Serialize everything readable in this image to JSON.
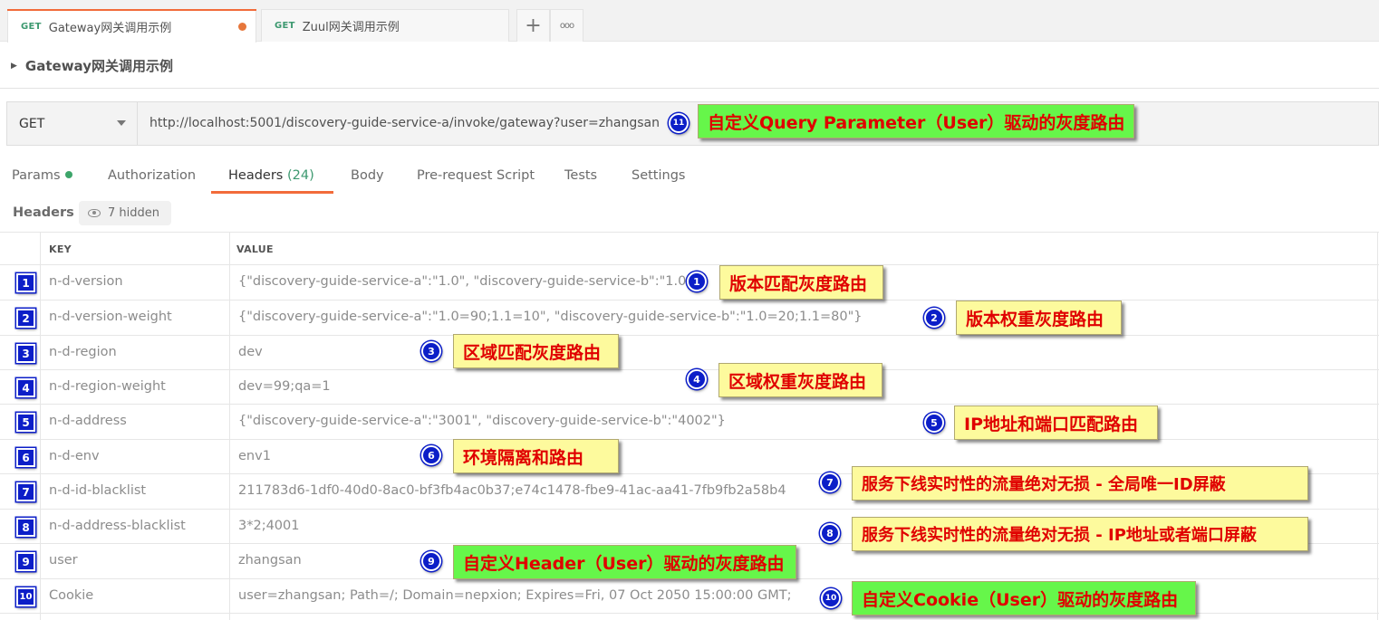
{
  "tabs": [
    {
      "method": "GET",
      "title": "Gateway网关调用示例",
      "active": true,
      "unsaved": true
    },
    {
      "method": "GET",
      "title": "Zuul网关调用示例",
      "active": false,
      "unsaved": false
    }
  ],
  "tab_actions": {
    "add_icon": "+",
    "more_icon": "ooo"
  },
  "breadcrumb": {
    "title": "Gateway网关调用示例"
  },
  "request": {
    "method": "GET",
    "url": "http://localhost:5001/discovery-guide-service-a/invoke/gateway?user=zhangsan"
  },
  "request_tabs": [
    {
      "label": "Params",
      "has_dot": true
    },
    {
      "label": "Authorization"
    },
    {
      "label": "Headers",
      "count": "(24)",
      "active": true
    },
    {
      "label": "Body"
    },
    {
      "label": "Pre-request Script"
    },
    {
      "label": "Tests"
    },
    {
      "label": "Settings"
    }
  ],
  "headers_section": {
    "label": "Headers",
    "hidden_text": "7 hidden"
  },
  "table": {
    "columns": [
      "KEY",
      "VALUE"
    ],
    "rows": [
      {
        "num": "1",
        "key": "n-d-version",
        "value": "{\"discovery-guide-service-a\":\"1.0\", \"discovery-guide-service-b\":\"1.0\"}"
      },
      {
        "num": "2",
        "key": "n-d-version-weight",
        "value": "{\"discovery-guide-service-a\":\"1.0=90;1.1=10\", \"discovery-guide-service-b\":\"1.0=20;1.1=80\"}"
      },
      {
        "num": "3",
        "key": "n-d-region",
        "value": "dev"
      },
      {
        "num": "4",
        "key": "n-d-region-weight",
        "value": "dev=99;qa=1"
      },
      {
        "num": "5",
        "key": "n-d-address",
        "value": "{\"discovery-guide-service-a\":\"3001\", \"discovery-guide-service-b\":\"4002\"}"
      },
      {
        "num": "6",
        "key": "n-d-env",
        "value": "env1"
      },
      {
        "num": "7",
        "key": "n-d-id-blacklist",
        "value": "211783d6-1df0-40d0-8ac0-bf3fb4ac0b37;e74c1478-fbe9-41ac-aa41-7fb9fb2a58b4"
      },
      {
        "num": "8",
        "key": "n-d-address-blacklist",
        "value": "3*2;4001"
      },
      {
        "num": "9",
        "key": "user",
        "value": "zhangsan"
      },
      {
        "num": "10",
        "key": "Cookie",
        "value": "user=zhangsan; Path=/; Domain=nepxion; Expires=Fri, 07 Oct 2050 15:00:00 GMT;"
      }
    ]
  },
  "annotations": [
    {
      "num": "11",
      "text": "自定义Query Parameter（User）驱动的灰度路由",
      "color": "#66f64a"
    },
    {
      "num": "1",
      "text": "版本匹配灰度路由",
      "color": "#fdfa9d"
    },
    {
      "num": "2",
      "text": "版本权重灰度路由",
      "color": "#fdfa9d"
    },
    {
      "num": "3",
      "text": "区域匹配灰度路由",
      "color": "#fdfa9d"
    },
    {
      "num": "4",
      "text": "区域权重灰度路由",
      "color": "#fdfa9d"
    },
    {
      "num": "5",
      "text": "IP地址和端口匹配路由",
      "color": "#fdfa9d"
    },
    {
      "num": "6",
      "text": "环境隔离和路由",
      "color": "#fdfa9d"
    },
    {
      "num": "7",
      "text": "服务下线实时性的流量绝对无损 - 全局唯一ID屏蔽",
      "color": "#fdfa9d"
    },
    {
      "num": "8",
      "text": "服务下线实时性的流量绝对无损 - IP地址或者端口屏蔽",
      "color": "#fdfa9d"
    },
    {
      "num": "9",
      "text": "自定义Header（User）驱动的灰度路由",
      "color": "#66f64a"
    },
    {
      "num": "10",
      "text": "自定义Cookie（User）驱动的灰度路由",
      "color": "#66f64a"
    }
  ],
  "colors": {
    "accent": "#f26b3a",
    "get_method": "#3d9970",
    "marker_blue": "#0c1ec8",
    "note_text": "#e00000"
  }
}
